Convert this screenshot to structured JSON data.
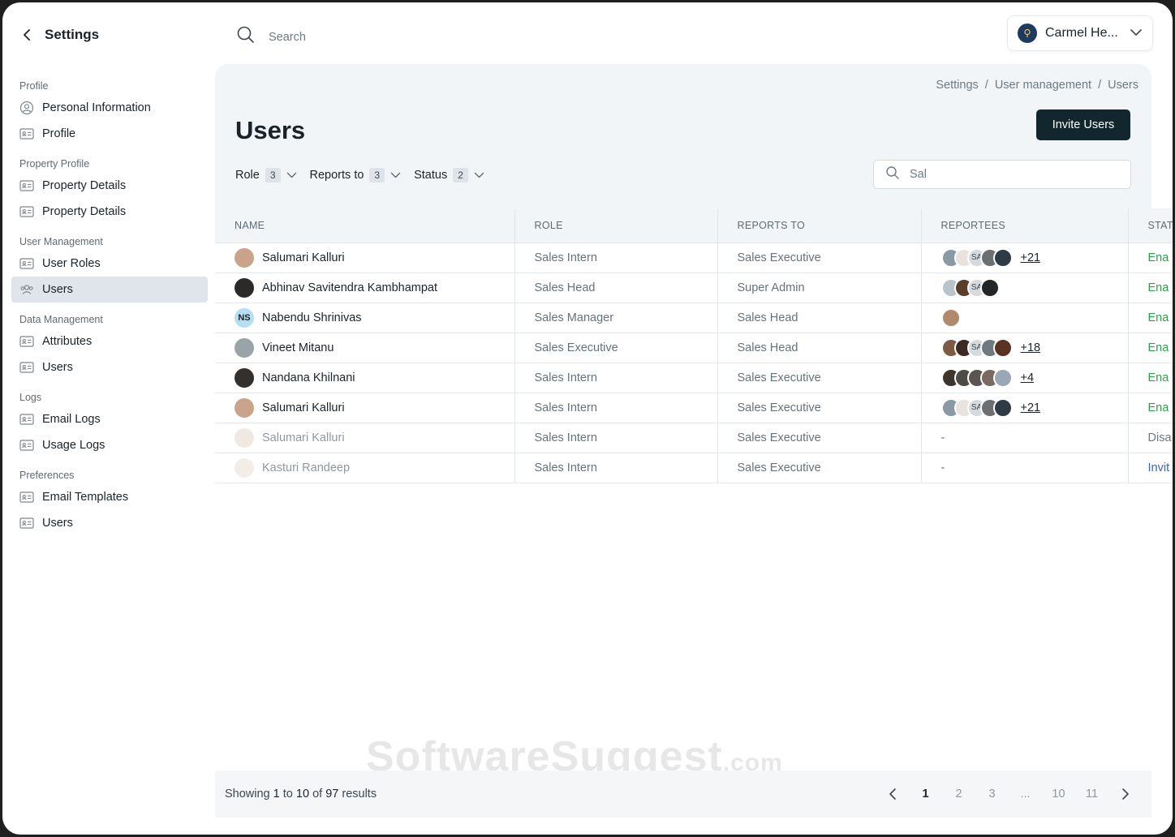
{
  "sidebar": {
    "title": "Settings",
    "sections": [
      {
        "title": "Profile",
        "items": [
          {
            "label": "Personal Information",
            "icon": "user-circle-icon"
          },
          {
            "label": "Profile",
            "icon": "id-card-icon"
          }
        ]
      },
      {
        "title": "Property Profile",
        "items": [
          {
            "label": "Property Details",
            "icon": "id-card-icon"
          },
          {
            "label": "Property Details",
            "icon": "id-card-icon"
          }
        ]
      },
      {
        "title": "User Management",
        "items": [
          {
            "label": "User Roles",
            "icon": "id-card-icon"
          },
          {
            "label": "Users",
            "icon": "users-group-icon",
            "active": true
          }
        ]
      },
      {
        "title": "Data Management",
        "items": [
          {
            "label": "Attributes",
            "icon": "id-card-icon"
          },
          {
            "label": "Users",
            "icon": "id-card-icon"
          }
        ]
      },
      {
        "title": "Logs",
        "items": [
          {
            "label": "Email Logs",
            "icon": "id-card-icon"
          },
          {
            "label": "Usage Logs",
            "icon": "id-card-icon"
          }
        ]
      },
      {
        "title": "Preferences",
        "items": [
          {
            "label": "Email Templates",
            "icon": "id-card-icon"
          },
          {
            "label": "Users",
            "icon": "id-card-icon"
          }
        ]
      }
    ]
  },
  "topbar": {
    "search_placeholder": "Search",
    "account_name": "Carmel He..."
  },
  "breadcrumb": [
    "Settings",
    "User management",
    "Users"
  ],
  "page": {
    "title": "Users",
    "invite_label": "Invite Users"
  },
  "filters": [
    {
      "label": "Role",
      "count": "3"
    },
    {
      "label": "Reports to",
      "count": "3"
    },
    {
      "label": "Status",
      "count": "2"
    }
  ],
  "table_search": {
    "value": "Sal"
  },
  "table": {
    "columns": [
      "NAME",
      "ROLE",
      "REPORTS TO",
      "REPORTEES",
      "STAT"
    ],
    "rows": [
      {
        "name": "Salumari Kalluri",
        "avatar": "",
        "avatar_color": "#c9a48a",
        "role": "Sales Intern",
        "reports_to": "Sales Executive",
        "reportees": [
          "#8a9aa5",
          "#e9e3df",
          "#d7dadd",
          "#6b6f72",
          "#2e3a44"
        ],
        "reportee_initials": [
          "",
          "",
          "SA",
          "",
          ""
        ],
        "more": "+21",
        "status": "Ena",
        "status_color": "#2e9e4a",
        "muted": false
      },
      {
        "name": "Abhinav Savitendra Kambhampat",
        "avatar": "",
        "avatar_color": "#2c2a28",
        "role": "Sales Head",
        "reports_to": "Super Admin",
        "reportees": [
          "#b9c3ca",
          "#5a3d2b",
          "#d7dadd",
          "#222629"
        ],
        "reportee_initials": [
          "",
          "",
          "SA",
          ""
        ],
        "more": "",
        "status": "Ena",
        "status_color": "#2e9e4a",
        "muted": false
      },
      {
        "name": "Nabendu Shrinivas",
        "avatar": "NS",
        "avatar_color": "#b5def0",
        "role": "Sales Manager",
        "reports_to": "Sales Head",
        "reportees": [
          "#b08a6a"
        ],
        "reportee_initials": [
          ""
        ],
        "more": "",
        "status": "Ena",
        "status_color": "#2e9e4a",
        "muted": false
      },
      {
        "name": "Vineet Mitanu",
        "avatar": "",
        "avatar_color": "#9aa3a8",
        "role": "Sales Executive",
        "reports_to": "Sales Head",
        "reportees": [
          "#7b5a46",
          "#3a2a22",
          "#d7dadd",
          "#6f7a80",
          "#5b3322"
        ],
        "reportee_initials": [
          "",
          "",
          "SA",
          "",
          ""
        ],
        "more": "+18",
        "status": "Ena",
        "status_color": "#2e9e4a",
        "muted": false
      },
      {
        "name": "Nandana Khilnani",
        "avatar": "",
        "avatar_color": "#33302e",
        "role": "Sales Intern",
        "reports_to": "Sales Executive",
        "reportees": [
          "#3d342e",
          "#4e4a48",
          "#5a5552",
          "#7a6a60",
          "#9aa8b4"
        ],
        "reportee_initials": [
          "",
          "",
          "",
          "",
          ""
        ],
        "more": "+4",
        "status": "Ena",
        "status_color": "#2e9e4a",
        "muted": false
      },
      {
        "name": "Salumari Kalluri",
        "avatar": "",
        "avatar_color": "#c9a48a",
        "role": "Sales Intern",
        "reports_to": "Sales Executive",
        "reportees": [
          "#8a9aa5",
          "#e9e3df",
          "#d7dadd",
          "#6b6f72",
          "#2e3a44"
        ],
        "reportee_initials": [
          "",
          "",
          "SA",
          "",
          ""
        ],
        "more": "+21",
        "status": "Ena",
        "status_color": "#2e9e4a",
        "muted": false
      },
      {
        "name": "Salumari Kalluri",
        "avatar": "",
        "avatar_color": "#e3d6cc",
        "role": "Sales Intern",
        "reports_to": "Sales Executive",
        "reportees": [],
        "reportee_initials": [],
        "dash": "-",
        "more": "",
        "status": "Disa",
        "status_color": "#6e7a82",
        "muted": true
      },
      {
        "name": "Kasturi Randeep",
        "avatar": "",
        "avatar_color": "#eadfd6",
        "role": "Sales Intern",
        "reports_to": "Sales Executive",
        "reportees": [],
        "reportee_initials": [],
        "dash": "-",
        "more": "",
        "status": "Invit",
        "status_color": "#3a67b0",
        "muted": true
      }
    ]
  },
  "footer": {
    "prefix": "Showing",
    "from": "1",
    "to_word": "to",
    "to": "10",
    "of_word": "of",
    "total": "97",
    "suffix": "results",
    "pages": [
      "1",
      "2",
      "3",
      "...",
      "10",
      "11"
    ],
    "current_page": "1"
  },
  "watermark": {
    "main": "SoftwareSuggest",
    "tld": ".com"
  }
}
